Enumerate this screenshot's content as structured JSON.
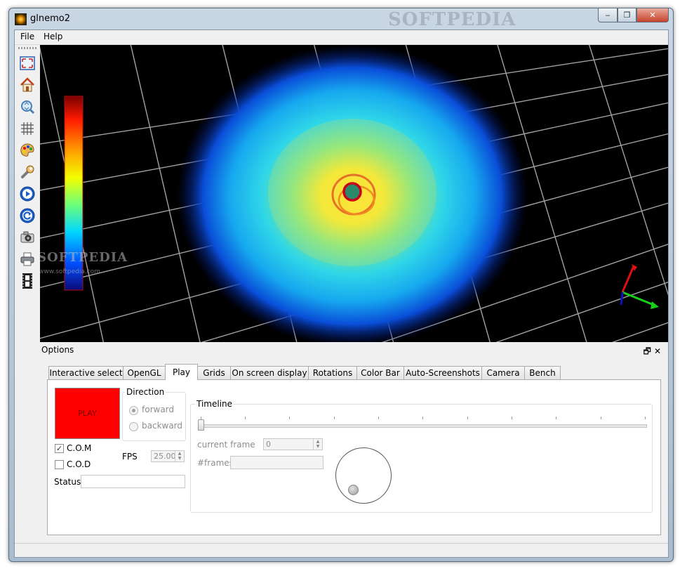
{
  "window": {
    "title": "glnemo2",
    "watermark": "SOFTPEDIA",
    "controls": {
      "minimize": "‒",
      "maximize": "❐",
      "close": "✕"
    }
  },
  "menu": {
    "items": [
      "File",
      "Help"
    ]
  },
  "toolbar": {
    "icons": [
      "fullscreen-icon",
      "home-icon",
      "zoom-fit-icon",
      "grid-icon",
      "palette-icon",
      "wrench-icon",
      "play-icon",
      "refresh-icon",
      "camera-icon",
      "print-icon",
      "film-icon"
    ]
  },
  "viewport": {
    "watermark": "SOFTPEDIA",
    "watermark_sub": "www.softpedia.com"
  },
  "options_dock": {
    "title": "Options",
    "float_label": "🗗",
    "close_label": "✕"
  },
  "tabs": [
    {
      "label": "Interactive select"
    },
    {
      "label": "OpenGL"
    },
    {
      "label": "Play",
      "active": true
    },
    {
      "label": "Grids"
    },
    {
      "label": "On screen display"
    },
    {
      "label": "Rotations"
    },
    {
      "label": "Color Bar"
    },
    {
      "label": "Auto-Screenshots"
    },
    {
      "label": "Camera"
    },
    {
      "label": "Bench"
    }
  ],
  "play": {
    "play_button": "PLAY",
    "direction": {
      "title": "Direction",
      "forward": "forward",
      "backward": "backward",
      "selected": "forward"
    },
    "com": {
      "label": "C.O.M",
      "checked": true,
      "mark": "✓"
    },
    "cod": {
      "label": "C.O.D",
      "checked": false
    },
    "fps": {
      "label": "FPS",
      "value": "25.00"
    },
    "status": {
      "label": "Status",
      "value": ""
    },
    "timeline": {
      "title": "Timeline",
      "current_frame_label": "current frame",
      "current_frame_value": "0",
      "frames_label": "#frames",
      "frames_value": ""
    }
  },
  "colors": {
    "accent_red": "#ff0000",
    "viewport_bg": "#000000",
    "grid": "#bfbfbf"
  }
}
